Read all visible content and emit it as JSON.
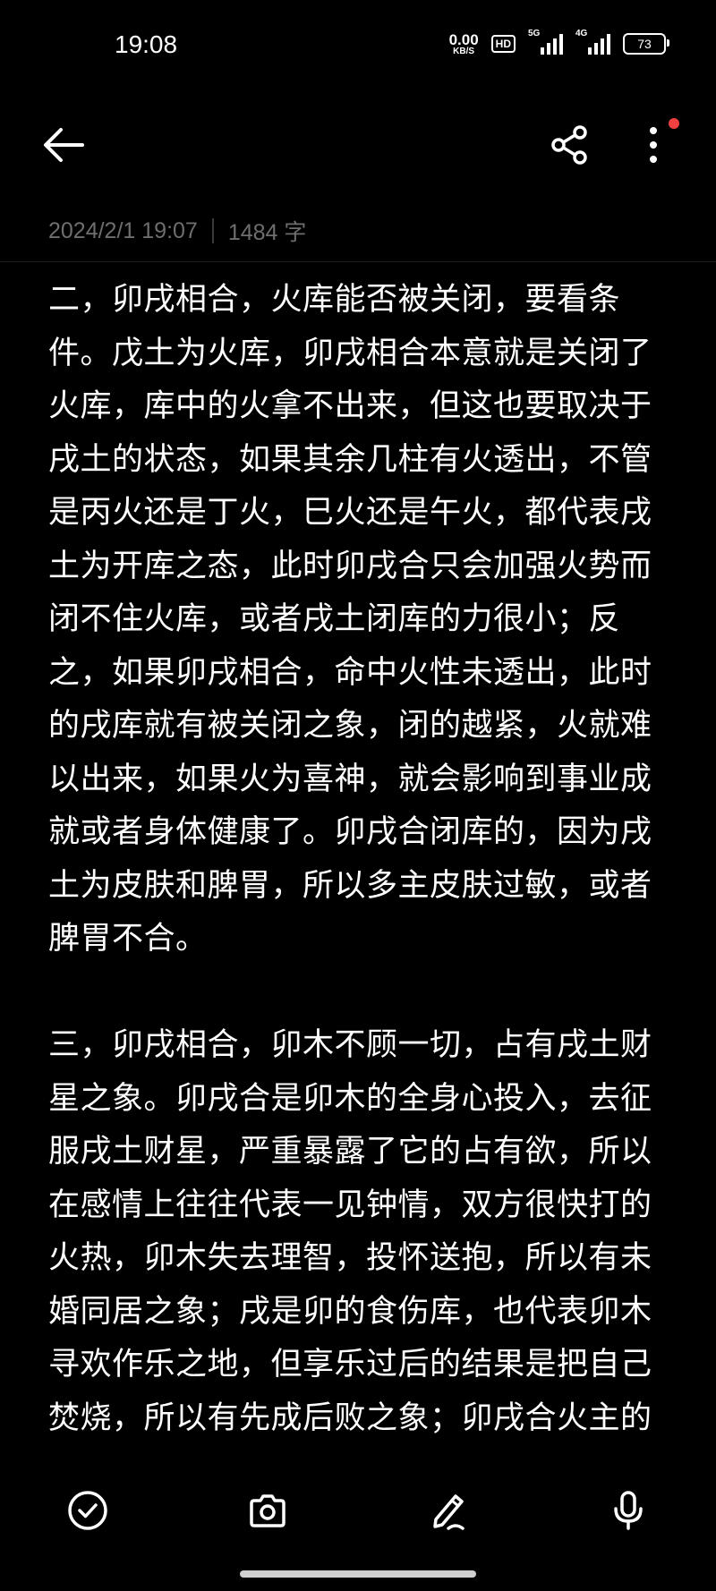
{
  "status_bar": {
    "time": "19:08",
    "net_speed_value": "0.00",
    "net_speed_unit": "KB/S",
    "hd_badge": "HD",
    "signal1_label": "5G",
    "signal2_label": "4G",
    "battery": "73"
  },
  "note": {
    "date": "2024/2/1 19:07",
    "char_count": "1484 字",
    "paragraphs": [
      "二，卯戌相合，火库能否被关闭，要看条件。戊土为火库，卯戌相合本意就是关闭了火库，库中的火拿不出来，但这也要取决于戌土的状态，如果其余几柱有火透出，不管是丙火还是丁火，巳火还是午火，都代表戌土为开库之态，此时卯戌合只会加强火势而闭不住火库，或者戌土闭库的力很小；反之，如果卯戌相合，命中火性未透出，此时的戌库就有被关闭之象，闭的越紧，火就难以出来，如果火为喜神，就会影响到事业成就或者身体健康了。卯戌合闭库的，因为戌土为皮肤和脾胃，所以多主皮肤过敏，或者脾胃不合。",
      "三，卯戌相合，卯木不顾一切，占有戌土财星之象。卯戌合是卯木的全身心投入，去征服戌土财星，严重暴露了它的占有欲，所以在感情上往往代表一见钟情，双方很快打的火热，卯木失去理智，投怀送抱，所以有未婚同居之象；戌是卯的食伤库，也代表卯木寻欢作乐之地，但享乐过后的结果是把自己焚烧，所以有先成后败之象；卯戌合火主的"
    ]
  },
  "colors": {
    "background": "#000000",
    "text": "#ffffff",
    "meta_text": "#6e6e6e",
    "notification_dot": "#f04040"
  }
}
